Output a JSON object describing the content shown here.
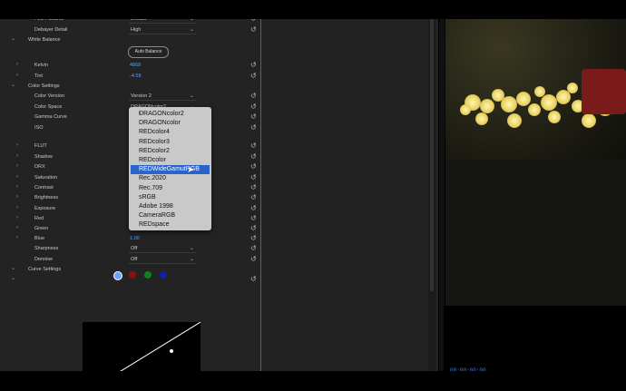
{
  "effect_controls": {
    "rows": [
      {
        "id": "flash",
        "label": "FLUT Source",
        "value": "Default",
        "kind": "select",
        "twirl": "",
        "indent": 38
      },
      {
        "id": "debayer",
        "label": "Debayer Detail",
        "value": "High",
        "kind": "select",
        "twirl": "",
        "indent": 38
      },
      {
        "id": "white-balance",
        "label": "White Balance",
        "value": "",
        "kind": "section",
        "twirl": "v",
        "indent": 31
      },
      {
        "id": "kelvin",
        "label": "Kelvin",
        "value": "4868",
        "kind": "number",
        "twirl": ">",
        "indent": 38
      },
      {
        "id": "tint",
        "label": "Tint",
        "value": "-4.58",
        "kind": "number",
        "twirl": ">",
        "indent": 38
      },
      {
        "id": "color-settings",
        "label": "Color Settings",
        "value": "",
        "kind": "section",
        "twirl": "v",
        "indent": 31
      },
      {
        "id": "color-version",
        "label": "Color Version",
        "value": "Version 2",
        "kind": "select",
        "twirl": "",
        "indent": 38
      },
      {
        "id": "color-space",
        "label": "Color Space",
        "value": "DRAGONcolor2",
        "kind": "select",
        "twirl": "",
        "indent": 38
      },
      {
        "id": "gamma-curve",
        "label": "Gamma Curve",
        "value": "",
        "kind": "select",
        "twirl": "",
        "indent": 38
      },
      {
        "id": "iso",
        "label": "ISO",
        "value": "",
        "kind": "select",
        "twirl": "",
        "indent": 38
      },
      {
        "id": "flut",
        "label": "FLUT",
        "value": "",
        "kind": "number",
        "twirl": ">",
        "indent": 38
      },
      {
        "id": "shadow",
        "label": "Shadow",
        "value": "",
        "kind": "number",
        "twirl": ">",
        "indent": 38
      },
      {
        "id": "drx",
        "label": "DRX",
        "value": "",
        "kind": "number",
        "twirl": ">",
        "indent": 38
      },
      {
        "id": "saturation",
        "label": "Saturation",
        "value": "",
        "kind": "number",
        "twirl": ">",
        "indent": 38
      },
      {
        "id": "contrast",
        "label": "Contrast",
        "value": "",
        "kind": "number",
        "twirl": ">",
        "indent": 38
      },
      {
        "id": "brightness",
        "label": "Brightness",
        "value": "",
        "kind": "number",
        "twirl": ">",
        "indent": 38
      },
      {
        "id": "exposure",
        "label": "Exposure",
        "value": "",
        "kind": "number",
        "twirl": ">",
        "indent": 38
      },
      {
        "id": "red",
        "label": "Red",
        "value": "",
        "kind": "number",
        "twirl": ">",
        "indent": 38
      },
      {
        "id": "green",
        "label": "Green",
        "value": "",
        "kind": "number",
        "twirl": ">",
        "indent": 38
      },
      {
        "id": "blue",
        "label": "Blue",
        "value": "1.00",
        "kind": "number",
        "twirl": ">",
        "indent": 38
      },
      {
        "id": "sharpness",
        "label": "Sharpness",
        "value": "Off",
        "kind": "select",
        "twirl": "",
        "indent": 38
      },
      {
        "id": "denoise",
        "label": "Denoise",
        "value": "Off",
        "kind": "select",
        "twirl": "",
        "indent": 38
      },
      {
        "id": "curve-settings",
        "label": "Curve Settings",
        "value": "",
        "kind": "section",
        "twirl": "v",
        "indent": 31
      },
      {
        "id": "curve-sub",
        "label": "",
        "value": "",
        "kind": "twirl",
        "twirl": "v",
        "indent": 31
      }
    ],
    "auto_balance_label": "Auto Balance",
    "curve_channels": [
      {
        "name": "luma",
        "color": "#ffffff",
        "selected": true
      },
      {
        "name": "red",
        "color": "#8a1010",
        "selected": false
      },
      {
        "name": "green",
        "color": "#12801a",
        "selected": false
      },
      {
        "name": "blue",
        "color": "#1020a0",
        "selected": false
      }
    ]
  },
  "color_space_dropdown": {
    "selected": "DRAGONcolor2",
    "highlighted": "REDWideGamutRGB",
    "options": [
      "DRAGONcolor2",
      "DRAGONcolor",
      "REDcolor4",
      "REDcolor3",
      "REDcolor2",
      "REDcolor",
      "REDWideGamutRGB",
      "Rec.2020",
      "Rec.709",
      "sRGB",
      "Adobe 1998",
      "CameraRGB",
      "REDspace"
    ]
  },
  "program_monitor": {
    "timecode": "00:00:00:00"
  },
  "colors": {
    "panel_bg": "#232323",
    "accent_blue": "#4aa3ff",
    "highlight": "#2a63c9",
    "separator": "#3a63b0"
  }
}
